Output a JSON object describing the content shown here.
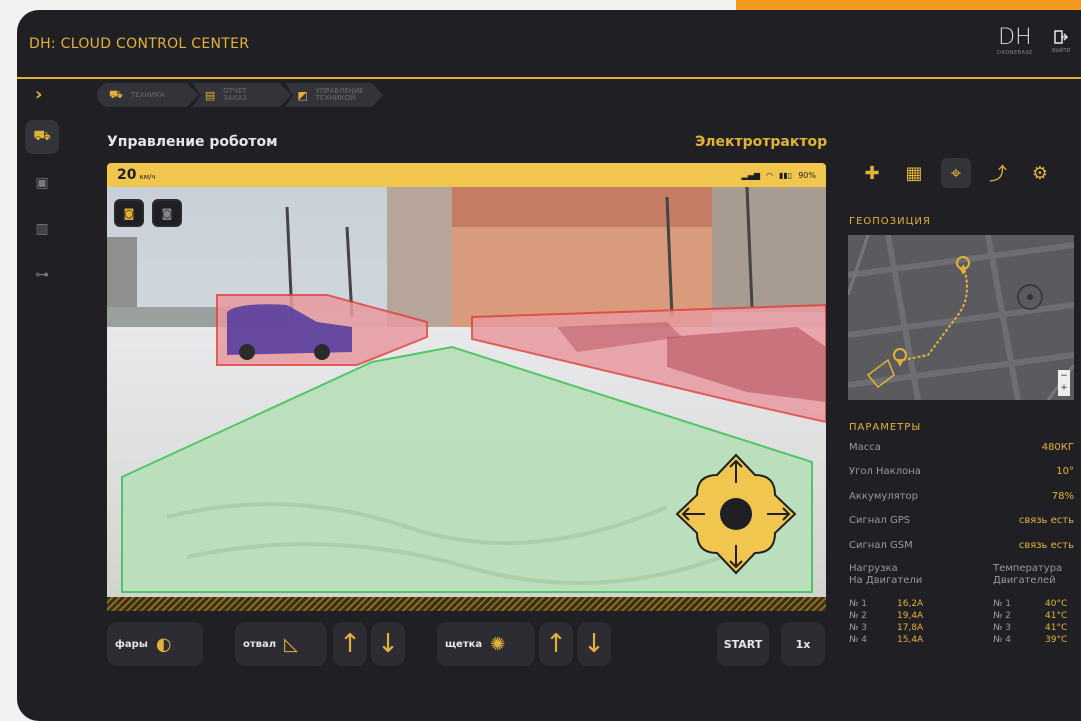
{
  "app": {
    "title": "DH: CLOUD CONTROL CENTER"
  },
  "logo": {
    "mark": "DH",
    "sub": "DRONEBASE"
  },
  "exit": {
    "label": "ВЫЙТИ"
  },
  "breadcrumbs": [
    {
      "label": "ТЕХНИКА",
      "icon": "tractor-icon"
    },
    {
      "label": "ОТЧЕТ ЗАКАЗ",
      "icon": "document-icon"
    },
    {
      "label": "УПРАВЛЕНИЕ ТЕХНИКОЙ",
      "icon": "chart-icon"
    }
  ],
  "section": {
    "title": "Управление роботом",
    "robot_type": "Электротрактор"
  },
  "status": {
    "speed": "20",
    "speed_unit": "км/ч",
    "battery": "90%"
  },
  "camera": {
    "btn1": "1",
    "btn2": "2"
  },
  "controls": {
    "lights": "фары",
    "blade": "отвал",
    "brush": "щетка",
    "start": "START",
    "speed_mult": "1x"
  },
  "geo": {
    "label": "ГЕОПОЗИЦИЯ"
  },
  "params": {
    "label": "ПАРАМЕТРЫ",
    "rows": [
      {
        "k": "Масса",
        "v": "480КГ"
      },
      {
        "k": "Угол Наклона",
        "v": "10°"
      },
      {
        "k": "Аккумулятор",
        "v": "78%"
      },
      {
        "k": "Сигнал GPS",
        "v": "связь есть"
      },
      {
        "k": "Сигнал GSM",
        "v": "связь есть"
      }
    ]
  },
  "loads": {
    "head1a": "Нагрузка",
    "head1b": "На Двигатели",
    "head2a": "Температура",
    "head2b": "Двигателей",
    "load": [
      {
        "n": "№ 1",
        "v": "16,2А"
      },
      {
        "n": "№ 2",
        "v": "19,4А"
      },
      {
        "n": "№ 3",
        "v": "17,8А"
      },
      {
        "n": "№ 4",
        "v": "15,4А"
      }
    ],
    "temp": [
      {
        "n": "№ 1",
        "v": "40°C"
      },
      {
        "n": "№ 2",
        "v": "41°C"
      },
      {
        "n": "№ 3",
        "v": "41°C"
      },
      {
        "n": "№ 4",
        "v": "39°C"
      }
    ]
  },
  "colors": {
    "accent": "#e2b13a",
    "bg": "#1f1f24",
    "panel": "#2c2c32"
  }
}
